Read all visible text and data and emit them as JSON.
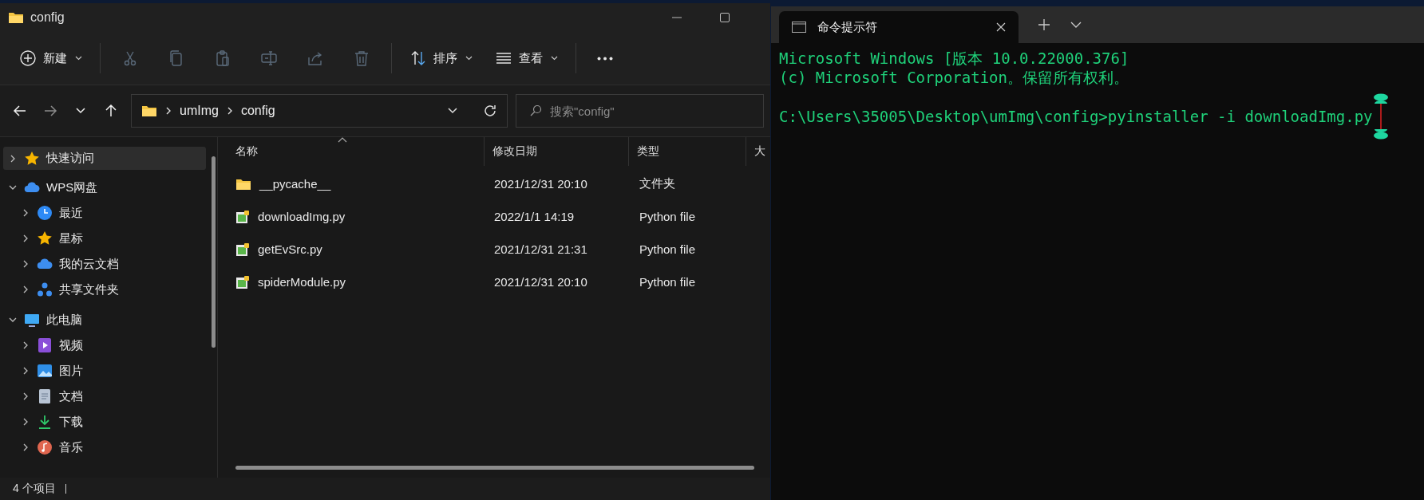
{
  "explorer": {
    "title": "config",
    "toolbar": [
      {
        "kind": "new",
        "label": "新建",
        "dropdown": true,
        "disabled": false
      },
      {
        "kind": "divider"
      },
      {
        "kind": "cut",
        "disabled": true
      },
      {
        "kind": "copy",
        "disabled": true
      },
      {
        "kind": "paste",
        "disabled": true
      },
      {
        "kind": "rename",
        "disabled": true
      },
      {
        "kind": "share",
        "disabled": true
      },
      {
        "kind": "delete",
        "disabled": true
      },
      {
        "kind": "divider"
      },
      {
        "kind": "sort",
        "label": "排序",
        "dropdown": true,
        "disabled": false
      },
      {
        "kind": "view",
        "label": "查看",
        "dropdown": true,
        "disabled": false
      },
      {
        "kind": "divider"
      },
      {
        "kind": "more",
        "disabled": false
      }
    ],
    "nav": [
      {
        "kind": "back",
        "disabled": false
      },
      {
        "kind": "forward",
        "disabled": true
      },
      {
        "kind": "recent",
        "disabled": false
      },
      {
        "kind": "up",
        "disabled": false
      }
    ],
    "path": [
      "umImg",
      "config"
    ],
    "search": {
      "placeholder": "搜索\"config\""
    },
    "sidebar": {
      "items": [
        {
          "label": "快速访问",
          "kind": "star",
          "expanded": false,
          "selected": true
        },
        {
          "label": "WPS网盘",
          "kind": "cloud",
          "expanded": true,
          "selected": false,
          "children": [
            {
              "label": "最近",
              "kind": "clock",
              "expanded": false,
              "selected": false
            },
            {
              "label": "星标",
              "kind": "star",
              "expanded": false,
              "selected": false
            },
            {
              "label": "我的云文档",
              "kind": "cloud",
              "expanded": false,
              "selected": false
            },
            {
              "label": "共享文件夹",
              "kind": "nodes",
              "expanded": false,
              "selected": false
            }
          ]
        },
        {
          "label": "此电脑",
          "kind": "pc",
          "expanded": true,
          "selected": false,
          "children": [
            {
              "label": "视频",
              "kind": "video",
              "expanded": false,
              "selected": false
            },
            {
              "label": "图片",
              "kind": "picture",
              "expanded": false,
              "selected": false
            },
            {
              "label": "文档",
              "kind": "document",
              "expanded": false,
              "selected": false
            },
            {
              "label": "下载",
              "kind": "download",
              "expanded": false,
              "selected": false
            },
            {
              "label": "音乐",
              "kind": "music",
              "expanded": false,
              "selected": false
            }
          ]
        }
      ]
    },
    "table": {
      "columns": [
        {
          "label": "名称",
          "sorted": true
        },
        {
          "label": "修改日期",
          "sorted": false
        },
        {
          "label": "类型",
          "sorted": false
        },
        {
          "label": "大",
          "sorted": false
        }
      ],
      "rows": [
        {
          "kind": "folder",
          "name": "__pycache__",
          "date": "2021/12/31 20:10",
          "type": "文件夹"
        },
        {
          "kind": "python",
          "name": "downloadImg.py",
          "date": "2022/1/1 14:19",
          "type": "Python file"
        },
        {
          "kind": "python",
          "name": "getEvSrc.py",
          "date": "2021/12/31 21:31",
          "type": "Python file"
        },
        {
          "kind": "python",
          "name": "spiderModule.py",
          "date": "2021/12/31 20:10",
          "type": "Python file"
        }
      ]
    },
    "status_bar": "4 个项目"
  },
  "terminal": {
    "tab": {
      "title": "命令提示符"
    },
    "lines": [
      "Microsoft Windows [版本 10.0.22000.376]",
      "(c) Microsoft Corporation。保留所有权利。"
    ],
    "prompt": "C:\\Users\\35005\\Desktop\\umImg\\config>pyinstaller -i downloadImg.py"
  }
}
